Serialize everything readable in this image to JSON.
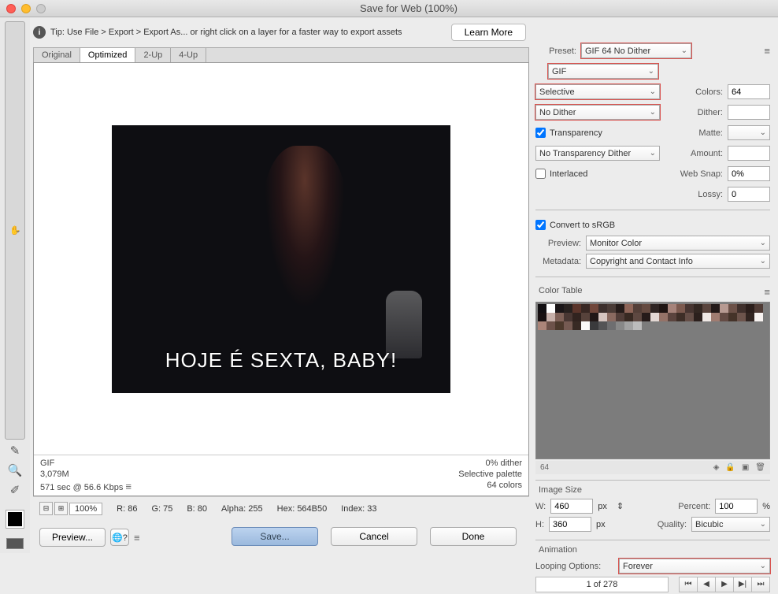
{
  "titlebar": {
    "title": "Save for Web (100%)"
  },
  "tip": {
    "text": "Tip: Use File > Export > Export As...  or right click on a layer for a faster way to export assets",
    "learn": "Learn More"
  },
  "tabs": [
    "Original",
    "Optimized",
    "2-Up",
    "4-Up"
  ],
  "canvas": {
    "caption": "HOJE É SEXTA, BABY!"
  },
  "imginfo": {
    "format": "GIF",
    "size": "3,079M",
    "time": "571 sec @ 56.6 Kbps",
    "dither": "0% dither",
    "palette": "Selective palette",
    "colors": "64 colors"
  },
  "status": {
    "zoom": "100%",
    "r": "R: 86",
    "g": "G: 75",
    "b": "B: 80",
    "alpha": "Alpha: 255",
    "hex": "Hex: 564B50",
    "index": "Index: 33"
  },
  "preset": {
    "label": "Preset:",
    "value": "GIF 64 No Dither"
  },
  "format": "GIF",
  "reduction": "Selective",
  "dither_algo": "No Dither",
  "colors_label": "Colors:",
  "colors_value": "64",
  "dither_label": "Dither:",
  "transparency": "Transparency",
  "trans_dither": "No Transparency Dither",
  "matte_label": "Matte:",
  "amount_label": "Amount:",
  "interlaced": "Interlaced",
  "websnap_label": "Web Snap:",
  "websnap_value": "0%",
  "lossy_label": "Lossy:",
  "lossy_value": "0",
  "srgb": "Convert to sRGB",
  "preview_label": "Preview:",
  "preview_value": "Monitor Color",
  "meta_label": "Metadata:",
  "meta_value": "Copyright and Contact Info",
  "colortable": "Color Table",
  "ct_count": "64",
  "imgsize": {
    "label": "Image Size",
    "w_label": "W:",
    "w": "460",
    "h_label": "H:",
    "h": "360",
    "px": "px",
    "percent_label": "Percent:",
    "percent": "100",
    "pct": "%",
    "quality_label": "Quality:",
    "quality": "Bicubic"
  },
  "animation": {
    "label": "Animation",
    "loop_label": "Looping Options:",
    "loop": "Forever",
    "frame": "1 of 278"
  },
  "buttons": {
    "preview": "Preview...",
    "save": "Save...",
    "cancel": "Cancel",
    "done": "Done"
  },
  "swatch_colors": [
    "#120f12",
    "#fff",
    "#1b1618",
    "#28211f",
    "#5a342a",
    "#382723",
    "#70463a",
    "#3c2f2c",
    "#4a3b36",
    "#261c1a",
    "#8e6558",
    "#543f38",
    "#654a40",
    "#2e2422",
    "#1f1513",
    "#a6837a",
    "#7c5a4f",
    "#473531",
    "#332722",
    "#59443d",
    "#231918",
    "#b79a92",
    "#6c5148",
    "#40302c",
    "#2b1e1b",
    "#4f3b35",
    "#191112",
    "#c7b0aa",
    "#7f6158",
    "#493733",
    "#31231f",
    "#57423b",
    "#211716",
    "#d6c5c0",
    "#8a6a60",
    "#523e39",
    "#382922",
    "#5e4841",
    "#261b1a",
    "#e3d8d4",
    "#957368",
    "#5b443e",
    "#3e2e27",
    "#654e47",
    "#2c201d",
    "#efe8e5",
    "#a07c71",
    "#644b44",
    "#453329",
    "#6d544c",
    "#322521",
    "#f7f2f0",
    "#ab8579",
    "#6d524a",
    "#4c392c",
    "#755a52",
    "#382a24",
    "#fbf9f8",
    "#3a3a3c",
    "#545456",
    "#6e6e70",
    "#888888",
    "#a2a2a2",
    "#bcbcbc"
  ]
}
